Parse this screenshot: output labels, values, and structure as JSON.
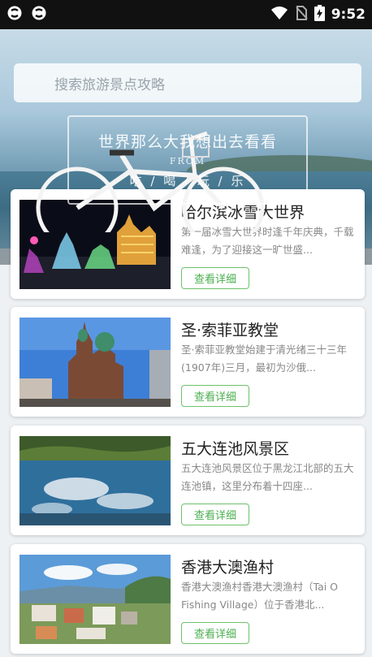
{
  "status_bar": {
    "time": "9:52",
    "left_icons": [
      "notification-app-icon",
      "notification-app-icon"
    ],
    "right_icons": [
      "wifi-icon",
      "no-sim-icon",
      "battery-charging-icon"
    ]
  },
  "search": {
    "placeholder": "搜索旅游景点攻略"
  },
  "banner": {
    "slogan": "世界那么大我想出去看看",
    "sub": "FROM",
    "tags": "吃 / 喝 / 玩 / 乐"
  },
  "attractions": [
    {
      "title": "哈尔滨冰雪大世界",
      "desc": "第一届冰雪大世界时逢千年庆典，千载难逢，为了迎接这一旷世盛...",
      "button": "查看详细",
      "image": "ice-festival-night"
    },
    {
      "title": "圣·索菲亚教堂",
      "desc": "圣·索菲亚教堂始建于清光绪三十三年(1907年)三月，最初为沙俄...",
      "button": "查看详细",
      "image": "cathedral"
    },
    {
      "title": "五大连池风景区",
      "desc": "五大连池风景区位于黑龙江北部的五大连池镇，这里分布着十四座...",
      "button": "查看详细",
      "image": "lake-reflection"
    },
    {
      "title": "香港大澳渔村",
      "desc": "香港大澳渔村香港大澳渔村（Tai O Fishing Village）位于香港北...",
      "button": "查看详细",
      "image": "fishing-village"
    }
  ],
  "colors": {
    "accent_green": "#4caf50",
    "status_bar": "#111111"
  }
}
